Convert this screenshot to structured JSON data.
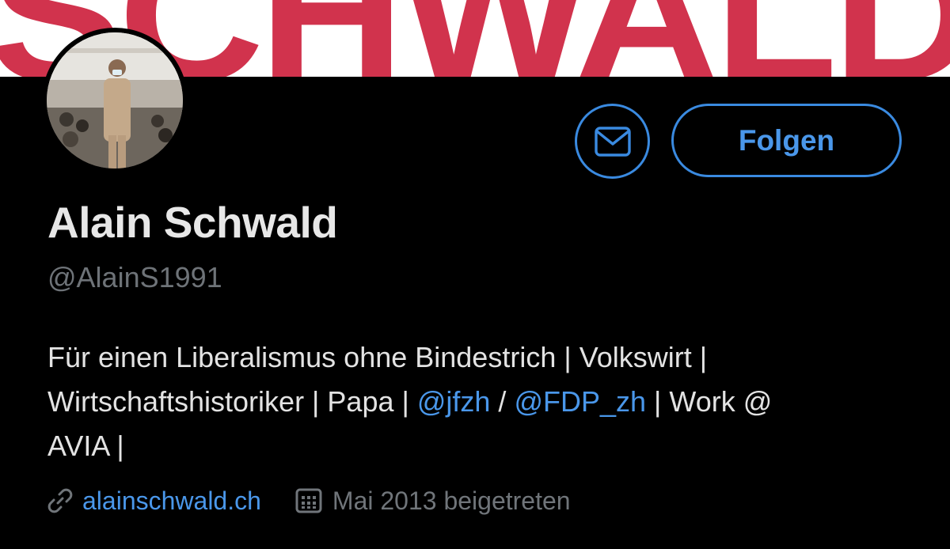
{
  "banner": {
    "text": "SCHWALD",
    "color": "#d1334d"
  },
  "profile": {
    "name": "Alain Schwald",
    "handle": "@AlainS1991",
    "bio": {
      "line1": "Für einen Liberalismus ohne Bindestrich | Volkswirt |",
      "line2_prefix": "Wirtschaftshistoriker | Papa | ",
      "mention1": "@jfzh",
      "separator": " / ",
      "mention2": "@FDP_zh",
      "line2_suffix": " | Work @",
      "line3": "AVIA |"
    },
    "website": "alainschwald.ch",
    "joined": "Mai 2013 beigetreten"
  },
  "actions": {
    "message_icon": "envelope-icon",
    "follow_label": "Folgen"
  },
  "icons": {
    "link": "link-icon",
    "calendar": "calendar-icon"
  },
  "colors": {
    "accent": "#3a8ae0",
    "link": "#4a97ea",
    "background": "#000000",
    "text_primary": "#e7e7e7",
    "text_secondary": "#70757a"
  }
}
